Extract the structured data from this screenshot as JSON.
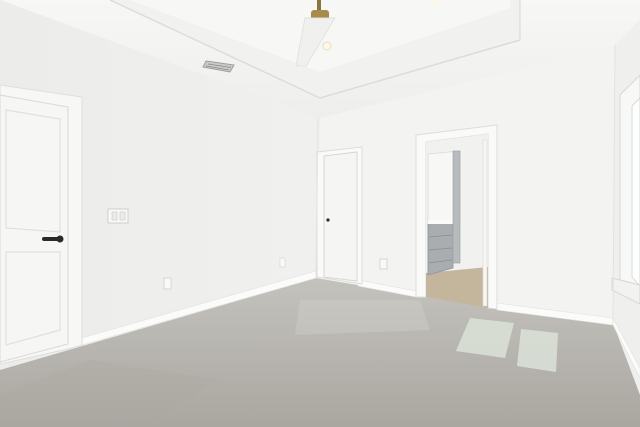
{
  "scene": {
    "palette": {
      "ceiling": "#f4f4f3",
      "wall_left": "#eeeeec",
      "wall_back": "#f3f3f1",
      "wall_right": "#efefed",
      "trim": "#fbfbfa",
      "door": "#f6f6f4",
      "floor": "#b9b7b2",
      "floor_shadow": "#a7a49f",
      "sunlight": "#d7ddd4",
      "window_glass": "#fdfefe",
      "vanity": "#a9adb0",
      "handle": "#2a2a2a"
    }
  }
}
